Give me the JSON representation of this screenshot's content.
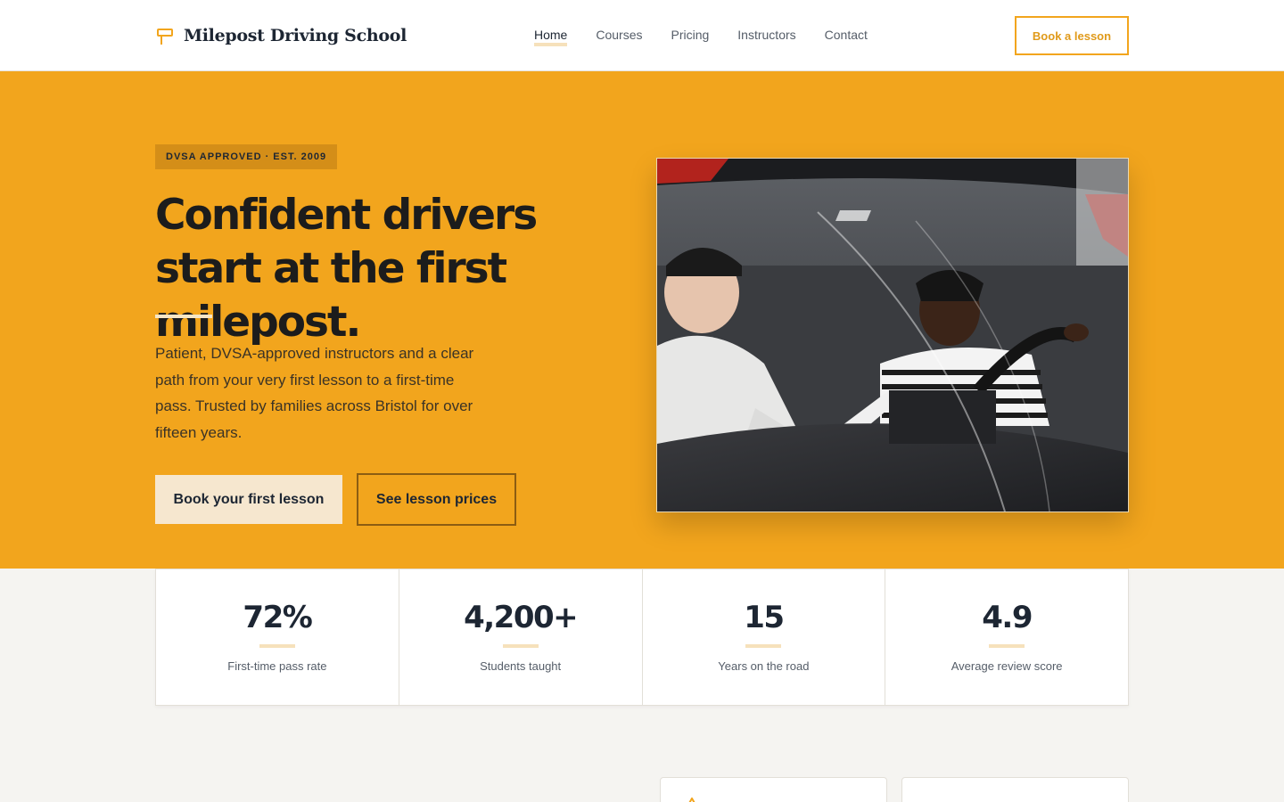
{
  "brand": {
    "name": "Milepost Driving School",
    "icon": "signpost-icon",
    "accent": "#f2a51d"
  },
  "nav": {
    "items": [
      {
        "label": "Home",
        "active": true
      },
      {
        "label": "Courses",
        "active": false
      },
      {
        "label": "Pricing",
        "active": false
      },
      {
        "label": "Instructors",
        "active": false
      },
      {
        "label": "Contact",
        "active": false
      }
    ],
    "cta_label": "Book a lesson"
  },
  "hero": {
    "badge": "DVSA APPROVED · EST. 2009",
    "title": "Confident drivers start at the first milepost.",
    "description": "Patient, DVSA-approved instructors and a clear path from your very first lesson to a first-time pass. Trusted by families across Bristol for over fifteen years.",
    "primary_cta": "Book your first lesson",
    "secondary_cta": "See lesson prices",
    "background": "#f2a51d"
  },
  "stats": [
    {
      "value": "72%",
      "label": "First-time pass rate"
    },
    {
      "value": "4,200+",
      "label": "Students taught"
    },
    {
      "value": "15",
      "label": "Years on the road"
    },
    {
      "value": "4.9",
      "label": "Average review score"
    }
  ]
}
